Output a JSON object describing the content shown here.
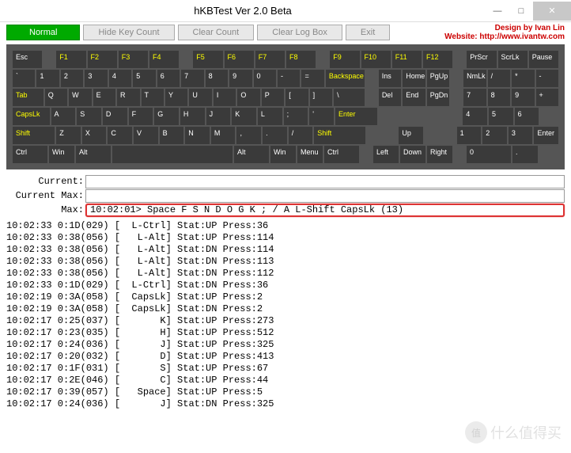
{
  "window": {
    "title": "hKBTest Ver 2.0 Beta",
    "min": "—",
    "max": "□",
    "close": "✕"
  },
  "toolbar": {
    "normal": "Normal",
    "hide": "Hide Key Count",
    "clear": "Clear Count",
    "clearlog": "Clear Log Box",
    "exit": "Exit"
  },
  "credit": {
    "line1": "Design by Ivan Lin",
    "line2": "Website: http://www.ivantw.com"
  },
  "kb": {
    "r0": [
      "Esc",
      "",
      "F1",
      "F2",
      "F3",
      "F4",
      "",
      "F5",
      "F6",
      "F7",
      "F8",
      "",
      "F9",
      "F10",
      "F11",
      "F12",
      "",
      "PrScr",
      "ScrLk",
      "Pause"
    ],
    "r1": [
      "`",
      "1",
      "2",
      "3",
      "4",
      "5",
      "6",
      "7",
      "8",
      "9",
      "0",
      "-",
      "=",
      "Backspace",
      "",
      "Ins",
      "Home",
      "PgUp",
      "",
      "NmLk",
      "/",
      "*",
      "-"
    ],
    "r2": [
      "Tab",
      "Q",
      "W",
      "E",
      "R",
      "T",
      "Y",
      "U",
      "I",
      "O",
      "P",
      "[",
      "]",
      "\\",
      "",
      "Del",
      "End",
      "PgDn",
      "",
      "7",
      "8",
      "9",
      "+"
    ],
    "r3": [
      "CapsLk",
      "A",
      "S",
      "D",
      "F",
      "G",
      "H",
      "J",
      "K",
      "L",
      ";",
      "'",
      "Enter",
      "",
      "",
      "",
      "",
      "",
      "4",
      "5",
      "6",
      ""
    ],
    "r4": [
      "Shift",
      "Z",
      "X",
      "C",
      "V",
      "B",
      "N",
      "M",
      ",",
      ".",
      "/",
      "Shift",
      "",
      "",
      "Up",
      "",
      "",
      "1",
      "2",
      "3",
      "Enter"
    ],
    "r5": [
      "Ctrl",
      "Win",
      "Alt",
      "",
      "Alt",
      "Win",
      "Menu",
      "Ctrl",
      "",
      "Left",
      "Down",
      "Right",
      "",
      "0",
      "."
    ]
  },
  "info": {
    "current_label": "Current:",
    "current_val": "",
    "curmax_label": "Current Max:",
    "curmax_val": "",
    "max_label": "Max:",
    "max_val": "10:02:01> Space F S N D O G K ; / A L-Shift CapsLk (13)"
  },
  "log": [
    "10:02:33 0:1D(029) [  L-Ctrl] Stat:UP Press:36",
    "10:02:33 0:38(056) [   L-Alt] Stat:UP Press:114",
    "10:02:33 0:38(056) [   L-Alt] Stat:DN Press:114",
    "10:02:33 0:38(056) [   L-Alt] Stat:DN Press:113",
    "10:02:33 0:38(056) [   L-Alt] Stat:DN Press:112",
    "10:02:33 0:1D(029) [  L-Ctrl] Stat:DN Press:36",
    "10:02:19 0:3A(058) [  CapsLk] Stat:UP Press:2",
    "10:02:19 0:3A(058) [  CapsLk] Stat:DN Press:2",
    "10:02:17 0:25(037) [       K] Stat:UP Press:273",
    "10:02:17 0:23(035) [       H] Stat:UP Press:512",
    "10:02:17 0:24(036) [       J] Stat:UP Press:325",
    "10:02:17 0:20(032) [       D] Stat:UP Press:413",
    "10:02:17 0:1F(031) [       S] Stat:UP Press:67",
    "10:02:17 0:2E(046) [       C] Stat:UP Press:44",
    "10:02:17 0:39(057) [   Space] Stat:UP Press:5",
    "10:02:17 0:24(036) [       J] Stat:DN Press:325"
  ],
  "watermark": "什么值得买"
}
